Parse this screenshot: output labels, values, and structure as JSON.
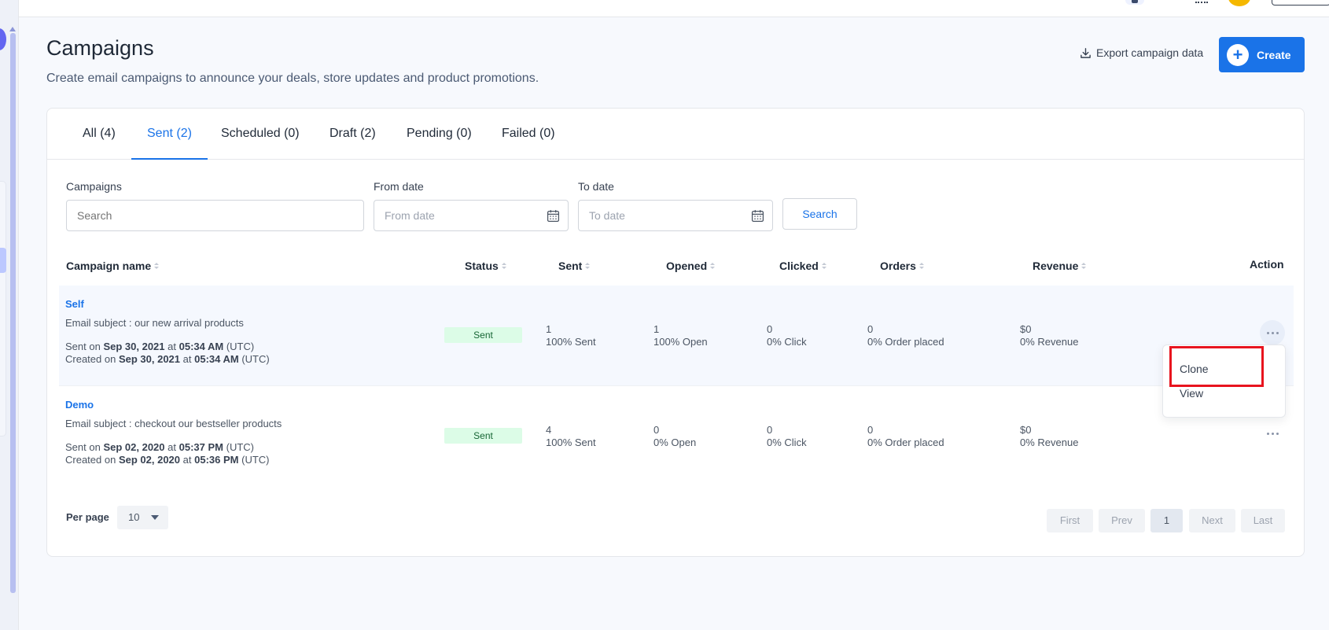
{
  "header": {
    "title": "Campaigns",
    "subtitle": "Create email campaigns to announce your deals, store updates and product promotions.",
    "export_label": "Export campaign data",
    "create_label": "Create"
  },
  "tabs": [
    {
      "label": "All (4)"
    },
    {
      "label": "Sent (2)",
      "active": true
    },
    {
      "label": "Scheduled (0)"
    },
    {
      "label": "Draft (2)"
    },
    {
      "label": "Pending (0)"
    },
    {
      "label": "Failed (0)"
    }
  ],
  "filters": {
    "campaigns_label": "Campaigns",
    "campaigns_placeholder": "Search",
    "from_label": "From date",
    "from_placeholder": "From date",
    "to_label": "To date",
    "to_placeholder": "To date",
    "search_button": "Search"
  },
  "table": {
    "headers": {
      "name": "Campaign name",
      "status": "Status",
      "sent": "Sent",
      "opened": "Opened",
      "clicked": "Clicked",
      "orders": "Orders",
      "revenue": "Revenue",
      "action": "Action"
    },
    "rows": [
      {
        "name": "Self",
        "subject": "Email subject : our new arrival products",
        "sent_prefix": "Sent on",
        "sent_date": "Sep 30, 2021",
        "sent_at": "at",
        "sent_time": "05:34 AM",
        "sent_tz": "(UTC)",
        "created_prefix": "Created on",
        "created_date": "Sep 30, 2021",
        "created_at": "at",
        "created_time": "05:34 AM",
        "created_tz": "(UTC)",
        "status": "Sent",
        "sent_count": "1",
        "sent_pct": "100% Sent",
        "opened_count": "1",
        "opened_pct": "100% Open",
        "clicked_count": "0",
        "clicked_pct": "0% Click",
        "orders_count": "0",
        "orders_pct": "0% Order placed",
        "revenue": "$0",
        "revenue_pct": "0% Revenue"
      },
      {
        "name": "Demo",
        "subject": "Email subject : checkout our bestseller products",
        "sent_prefix": "Sent on",
        "sent_date": "Sep 02, 2020",
        "sent_at": "at",
        "sent_time": "05:37 PM",
        "sent_tz": "(UTC)",
        "created_prefix": "Created on",
        "created_date": "Sep 02, 2020",
        "created_at": "at",
        "created_time": "05:36 PM",
        "created_tz": "(UTC)",
        "status": "Sent",
        "sent_count": "4",
        "sent_pct": "100% Sent",
        "opened_count": "0",
        "opened_pct": "0% Open",
        "clicked_count": "0",
        "clicked_pct": "0% Click",
        "orders_count": "0",
        "orders_pct": "0% Order placed",
        "revenue": "$0",
        "revenue_pct": "0% Revenue"
      }
    ]
  },
  "dropdown": {
    "items": [
      "Clone",
      "View"
    ]
  },
  "pagination": {
    "per_page_label": "Per page",
    "per_page_value": "10",
    "first": "First",
    "prev": "Prev",
    "current": "1",
    "next": "Next",
    "last": "Last"
  },
  "colors": {
    "accent": "#1a73e8",
    "status_sent_bg": "#dcfce7",
    "highlight": "#e8141e"
  },
  "icons": {
    "export": "download-icon",
    "create": "plus-icon",
    "calendar": "calendar-icon",
    "sort": "sort-icon",
    "more": "more-horizontal-icon"
  }
}
